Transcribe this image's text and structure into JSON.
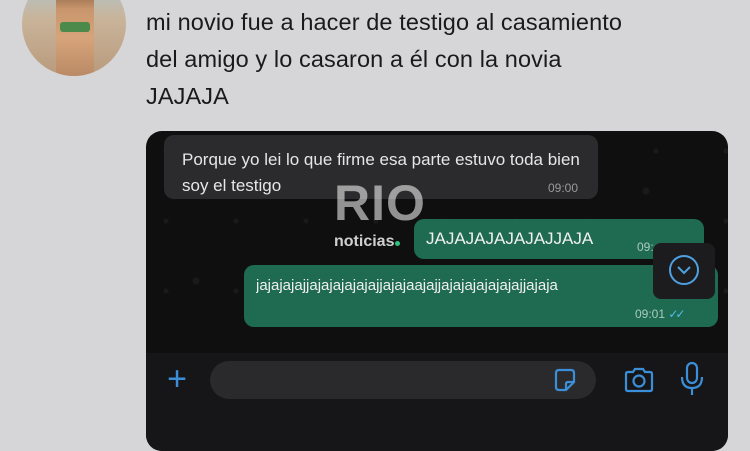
{
  "tweet": {
    "lines": [
      "mi novio fue a hacer de testigo al casamiento",
      "del amigo y lo casaron a él con la novia",
      "JAJAJA"
    ]
  },
  "chat": {
    "incoming": {
      "text": "Porque yo lei lo que firme esa parte estuvo toda bien soy el testigo",
      "time": "09:00"
    },
    "outgoing": [
      {
        "text": "JAJAJAJAJAJAJJAJA",
        "time": "09:"
      },
      {
        "text": "jajajajajjajajajajajajjajajaajajjajajajajajajajjajaja",
        "time": "09:01"
      }
    ]
  },
  "watermark": {
    "brand": "RIO",
    "sub": "noticias"
  },
  "icons": {
    "scroll": "chevron-down-icon",
    "plus": "plus-icon",
    "sticker": "sticker-icon",
    "camera": "camera-icon",
    "mic": "microphone-icon"
  },
  "colors": {
    "accent": "#3b8ed8",
    "outgoing_bubble": "#1f6b52",
    "incoming_bubble": "#2b2b2d"
  }
}
